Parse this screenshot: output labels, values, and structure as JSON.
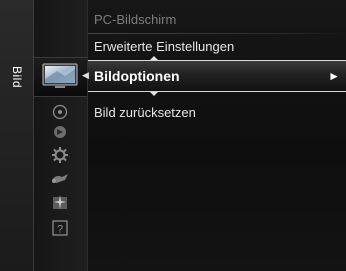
{
  "category": {
    "label": "Bild"
  },
  "menu": {
    "items": [
      {
        "label": "PC-Bildschirm",
        "state": "disabled"
      },
      {
        "label": "Erweiterte Einstellungen",
        "state": "normal"
      },
      {
        "label": "Bildoptionen",
        "state": "selected",
        "arrow": "►"
      },
      {
        "label": "Bild zurücksetzen",
        "state": "normal"
      }
    ]
  },
  "icons": [
    "picture-icon",
    "sound-icon",
    "channel-icon",
    "setup-icon",
    "input-icon",
    "application-icon",
    "support-icon"
  ],
  "colors": {
    "background": "#151515",
    "text": "#e6e6e6",
    "disabled_text": "#7d7d7d",
    "highlight_border": "#d8d8d8"
  }
}
